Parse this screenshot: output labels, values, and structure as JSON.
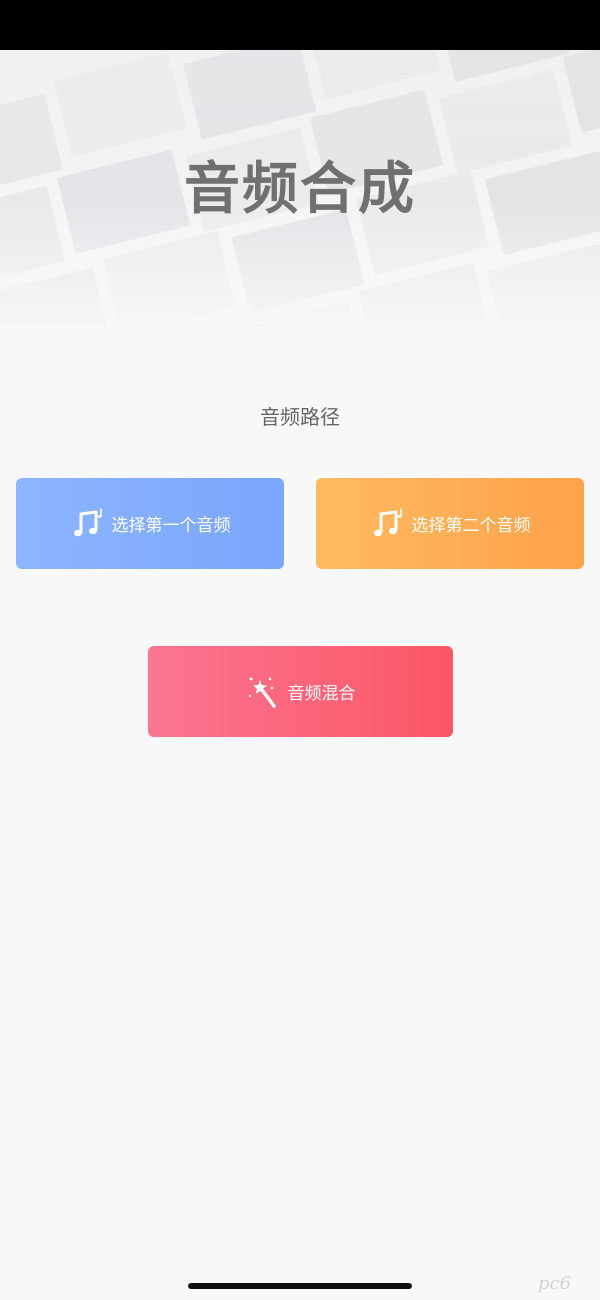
{
  "header": {
    "title": "音频合成"
  },
  "main": {
    "section_label": "音频路径",
    "buttons": {
      "first": {
        "label": "选择第一个音频",
        "icon": "music-note-icon"
      },
      "second": {
        "label": "选择第二个音频",
        "icon": "music-note-icon"
      },
      "mix": {
        "label": "音频混合",
        "icon": "magic-wand-icon"
      }
    }
  },
  "watermark": "pc6",
  "colors": {
    "background": "#f8f8f8",
    "first_button": "#82adfd",
    "second_button": "#ffae55",
    "mix_button": "#fb6478",
    "title_text": "#707070"
  }
}
